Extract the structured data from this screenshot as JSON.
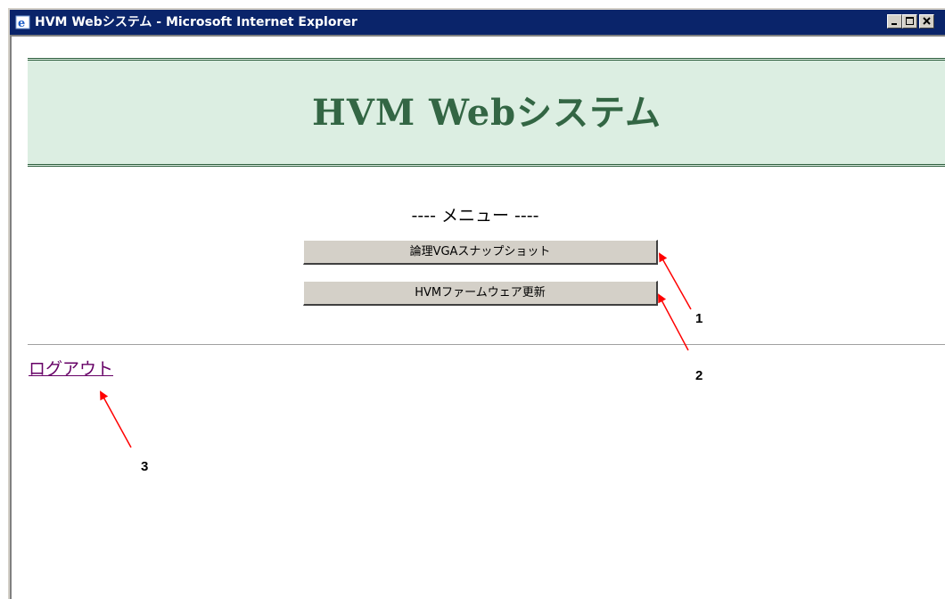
{
  "window": {
    "title": "HVM Webシステム - Microsoft Internet Explorer",
    "controls": [
      "minimize-icon",
      "maximize-icon",
      "close-icon"
    ]
  },
  "page": {
    "banner_title": "HVM Webシステム",
    "menu_heading": "---- メニュー ----",
    "buttons": [
      {
        "label": "論理VGAスナップショット"
      },
      {
        "label": "HVMファームウェア更新"
      }
    ],
    "logout_label": "ログアウト"
  },
  "annotations": {
    "callouts": [
      "1",
      "2",
      "3"
    ],
    "arrow_color": "#ff0000"
  },
  "colors": {
    "titlebar": "#0a246a",
    "banner_bg": "#dceee2",
    "banner_text": "#336644",
    "link": "#660066"
  }
}
